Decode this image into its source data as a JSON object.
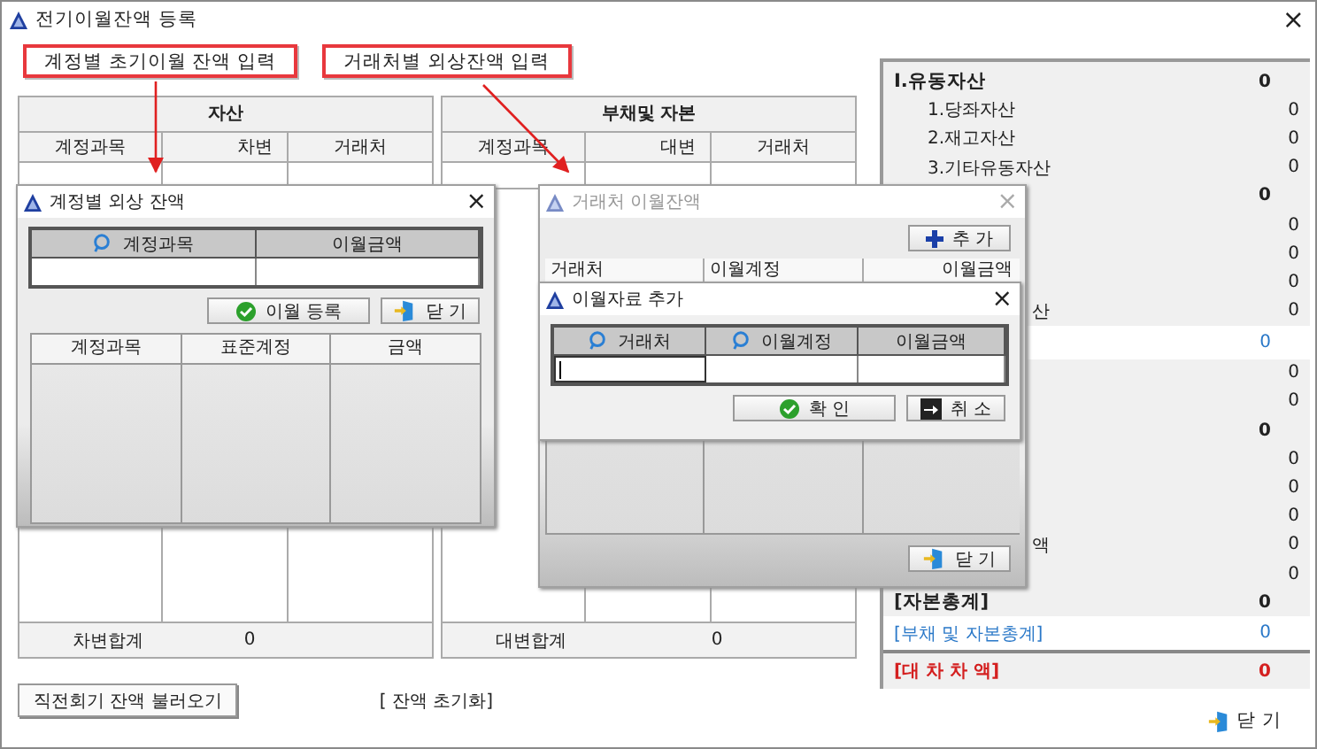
{
  "window": {
    "title": "전기이월잔액 등록",
    "close": "×"
  },
  "callouts": [
    "계정별 초기이월 잔액 입력",
    "거래처별 외상잔액 입력"
  ],
  "assets_table": {
    "title": "자산",
    "columns": [
      "계정과목",
      "차변",
      "거래처"
    ],
    "total_label": "차변합계",
    "total_value": "0"
  },
  "liabilities_table": {
    "title": "부채및 자본",
    "columns": [
      "계정과목",
      "대변",
      "거래처"
    ],
    "total_label": "대변합계",
    "total_value": "0"
  },
  "summary": [
    {
      "kind": "heading",
      "label": "Ⅰ.유동자산",
      "value": "0"
    },
    {
      "kind": "item",
      "label": "1.당좌자산",
      "value": "0"
    },
    {
      "kind": "item",
      "label": "2.재고자산",
      "value": "0"
    },
    {
      "kind": "item",
      "label": "3.기타유동자산",
      "value": "0"
    },
    {
      "kind": "heading",
      "value": "0"
    },
    {
      "kind": "item",
      "value": "0"
    },
    {
      "kind": "item",
      "value": "0"
    },
    {
      "kind": "item",
      "value": "0"
    },
    {
      "kind": "cut",
      "label": "산",
      "value": "0"
    },
    {
      "kind": "total",
      "value": "0"
    },
    {
      "kind": "item",
      "value": "0"
    },
    {
      "kind": "item",
      "value": "0"
    },
    {
      "kind": "heading",
      "value": "0"
    },
    {
      "kind": "item",
      "value": "0"
    },
    {
      "kind": "item",
      "value": "0"
    },
    {
      "kind": "item",
      "value": "0"
    },
    {
      "kind": "cut",
      "label": "액",
      "value": "0"
    },
    {
      "kind": "item",
      "value": "0"
    },
    {
      "kind": "heading",
      "label": "[자본총계]",
      "value": "0"
    },
    {
      "kind": "total",
      "label": "[부채 및 자본총계]",
      "value": "0"
    },
    {
      "kind": "diff",
      "label": "[대 차 차 액]",
      "value": "0"
    }
  ],
  "bottom": {
    "load_button": "직전회기 잔액 불러오기",
    "reset_link": "[ 잔액 초기화]",
    "close_button": "닫 기"
  },
  "account_dialog": {
    "title": "계정별 외상 잔액",
    "active": true,
    "close": "×",
    "columns": [
      "계정과목",
      "이월금액"
    ],
    "buttons": [
      "이월 등록",
      "닫 기"
    ],
    "list_columns": [
      "계정과목",
      "표준계정",
      "금액"
    ]
  },
  "vendor_dialog": {
    "title": "거래처 이월잔액",
    "active": false,
    "close": "×",
    "add_button": "추 가",
    "columns": [
      "거래처",
      "이월계정",
      "이월금액"
    ],
    "close_button": "닫 기"
  },
  "add_dialog": {
    "title": "이월자료 추가",
    "active": true,
    "close": "×",
    "columns": [
      "거래처",
      "이월계정",
      "이월금액"
    ],
    "buttons": [
      "확 인",
      "취 소"
    ]
  }
}
